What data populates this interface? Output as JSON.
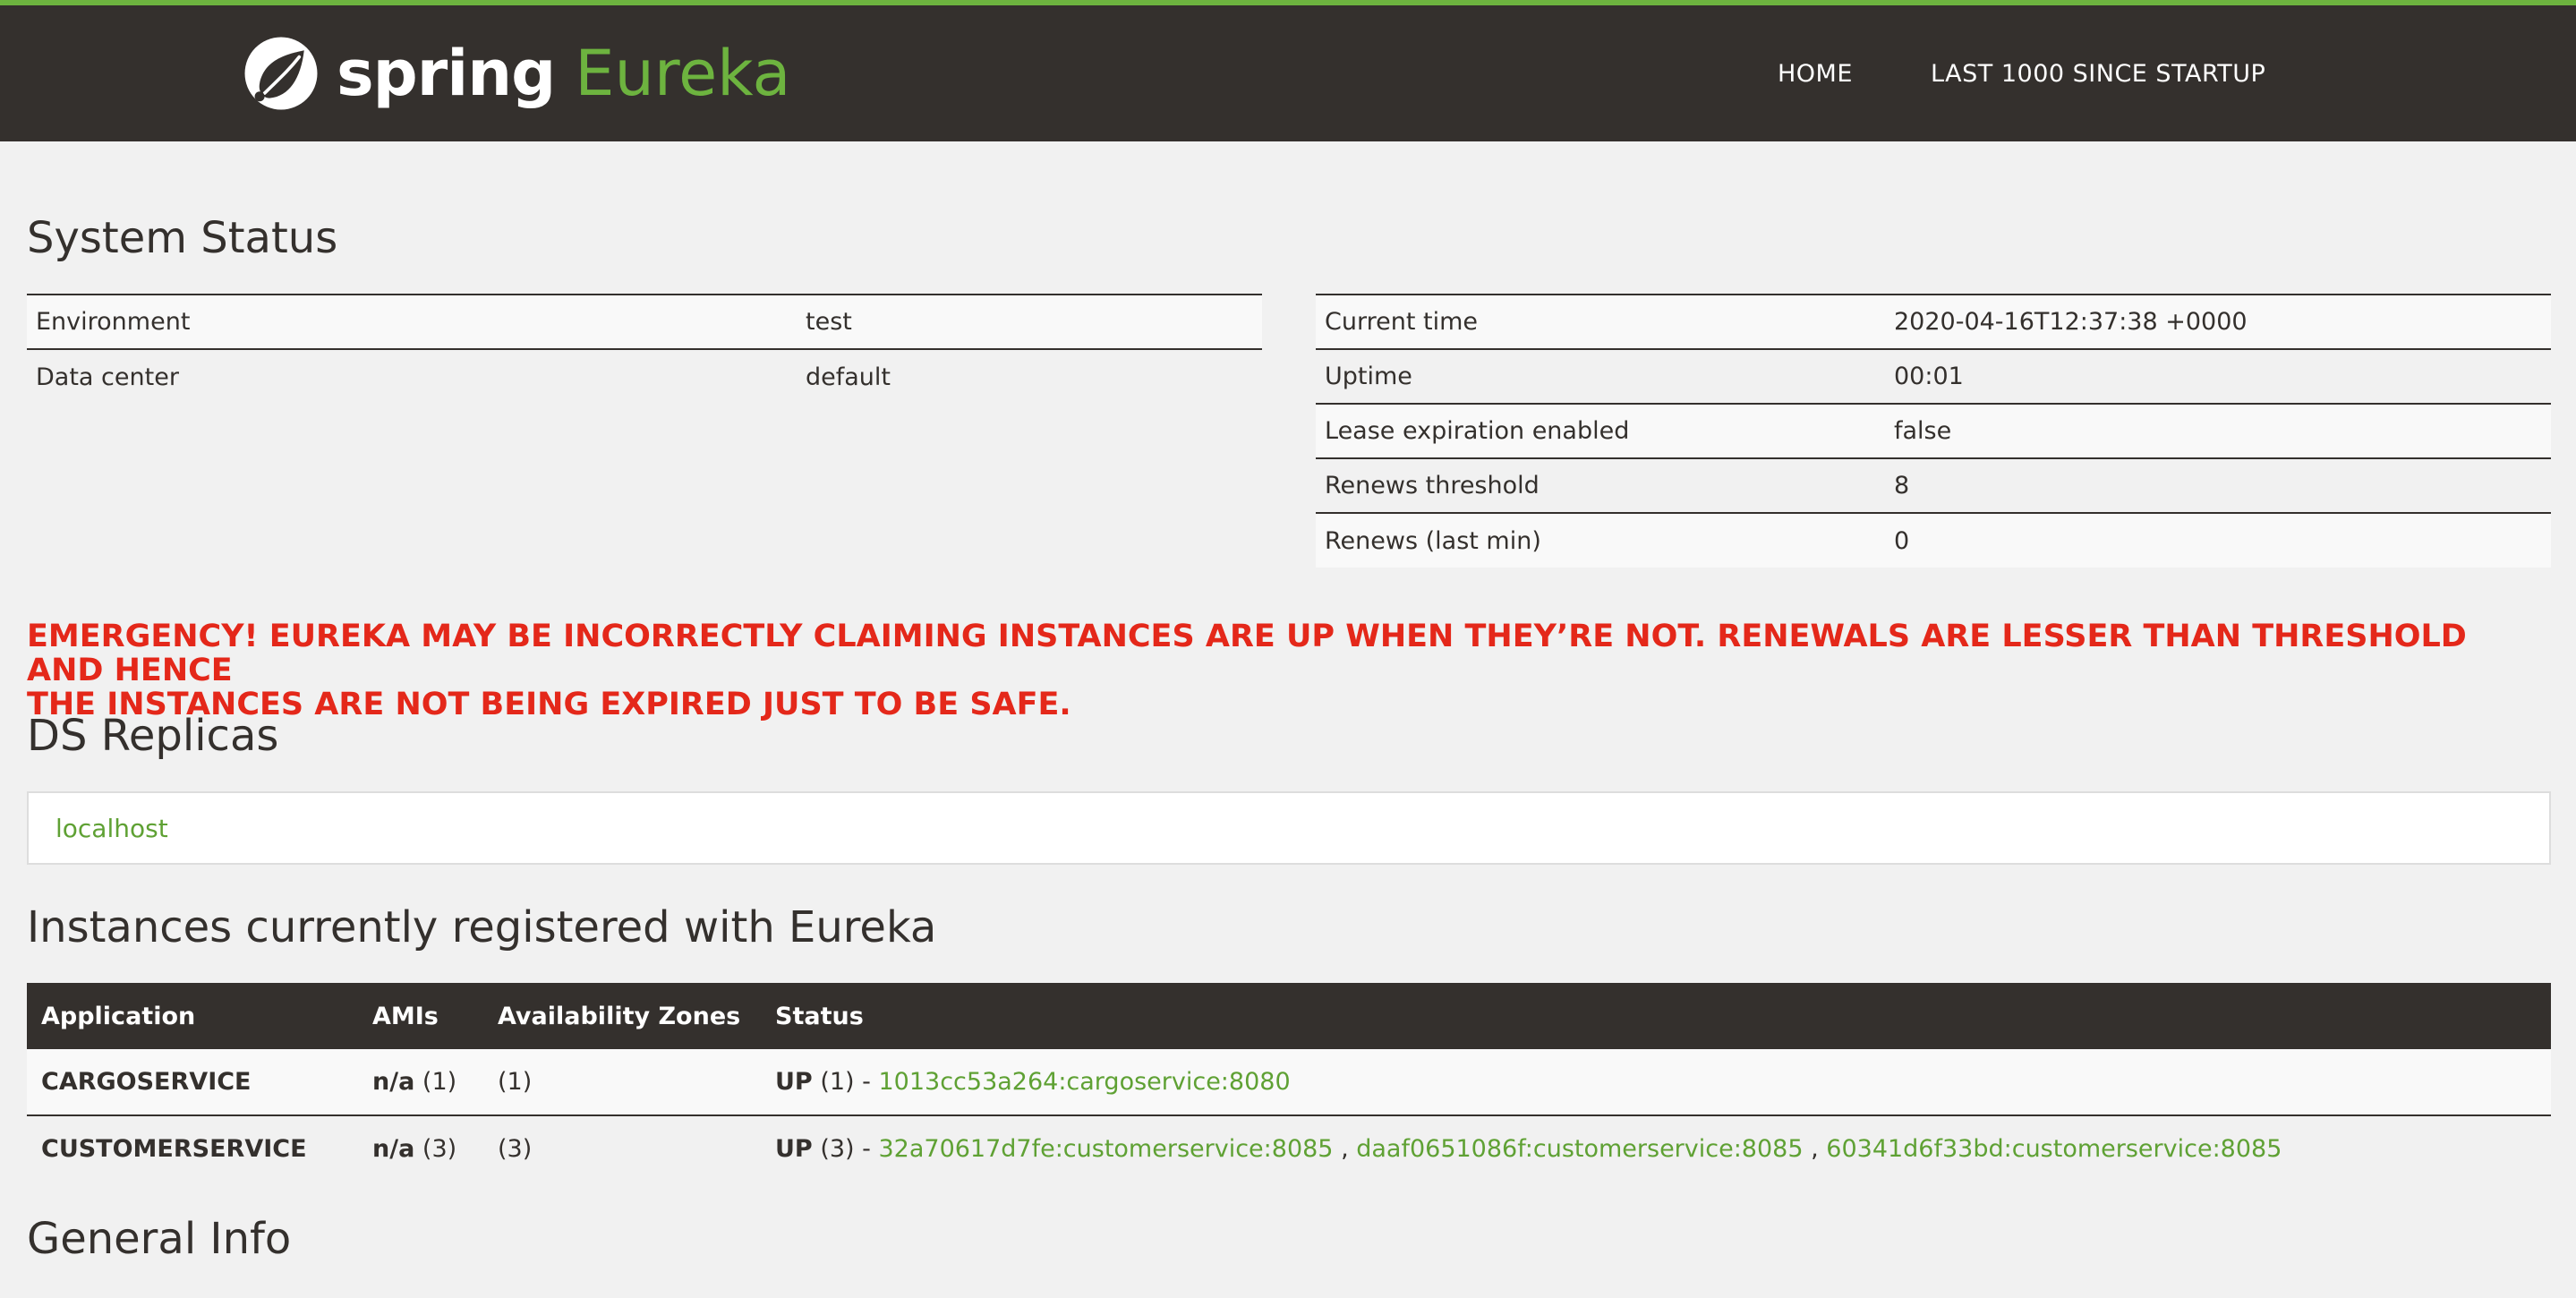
{
  "header": {
    "logo_word_1": "spring",
    "logo_word_2": "Eureka",
    "nav": [
      {
        "label": "HOME"
      },
      {
        "label": "LAST 1000 SINCE STARTUP"
      }
    ]
  },
  "system_status": {
    "title": "System Status",
    "left": [
      {
        "key": "Environment",
        "value": "test"
      },
      {
        "key": "Data center",
        "value": "default"
      }
    ],
    "right": [
      {
        "key": "Current time",
        "value": "2020-04-16T12:37:38 +0000"
      },
      {
        "key": "Uptime",
        "value": "00:01"
      },
      {
        "key": "Lease expiration enabled",
        "value": "false"
      },
      {
        "key": "Renews threshold",
        "value": "8"
      },
      {
        "key": "Renews (last min)",
        "value": "0"
      }
    ]
  },
  "emergency": {
    "line1": "EMERGENCY! EUREKA MAY BE INCORRECTLY CLAIMING INSTANCES ARE UP WHEN THEY’RE NOT. RENEWALS ARE LESSER THAN THRESHOLD AND HENCE",
    "line2": "THE INSTANCES ARE NOT BEING EXPIRED JUST TO BE SAFE."
  },
  "replicas": {
    "title": "DS Replicas",
    "items": [
      {
        "label": "localhost"
      }
    ]
  },
  "instances": {
    "title": "Instances currently registered with Eureka",
    "headers": [
      "Application",
      "AMIs",
      "Availability Zones",
      "Status"
    ],
    "rows": [
      {
        "application": "CARGOSERVICE",
        "ami": "n/a",
        "ami_count": "(1)",
        "zones": "(1)",
        "status": "UP",
        "status_count": "(1) -",
        "links": [
          "1013cc53a264:cargoservice:8080"
        ]
      },
      {
        "application": "CUSTOMERSERVICE",
        "ami": "n/a",
        "ami_count": "(3)",
        "zones": "(3)",
        "status": "UP",
        "status_count": "(3) -",
        "links": [
          "32a70617d7fe:customerservice:8085",
          "daaf0651086f:customerservice:8085",
          "60341d6f33bd:customerservice:8085"
        ]
      }
    ]
  },
  "general_info": {
    "title": "General Info"
  }
}
